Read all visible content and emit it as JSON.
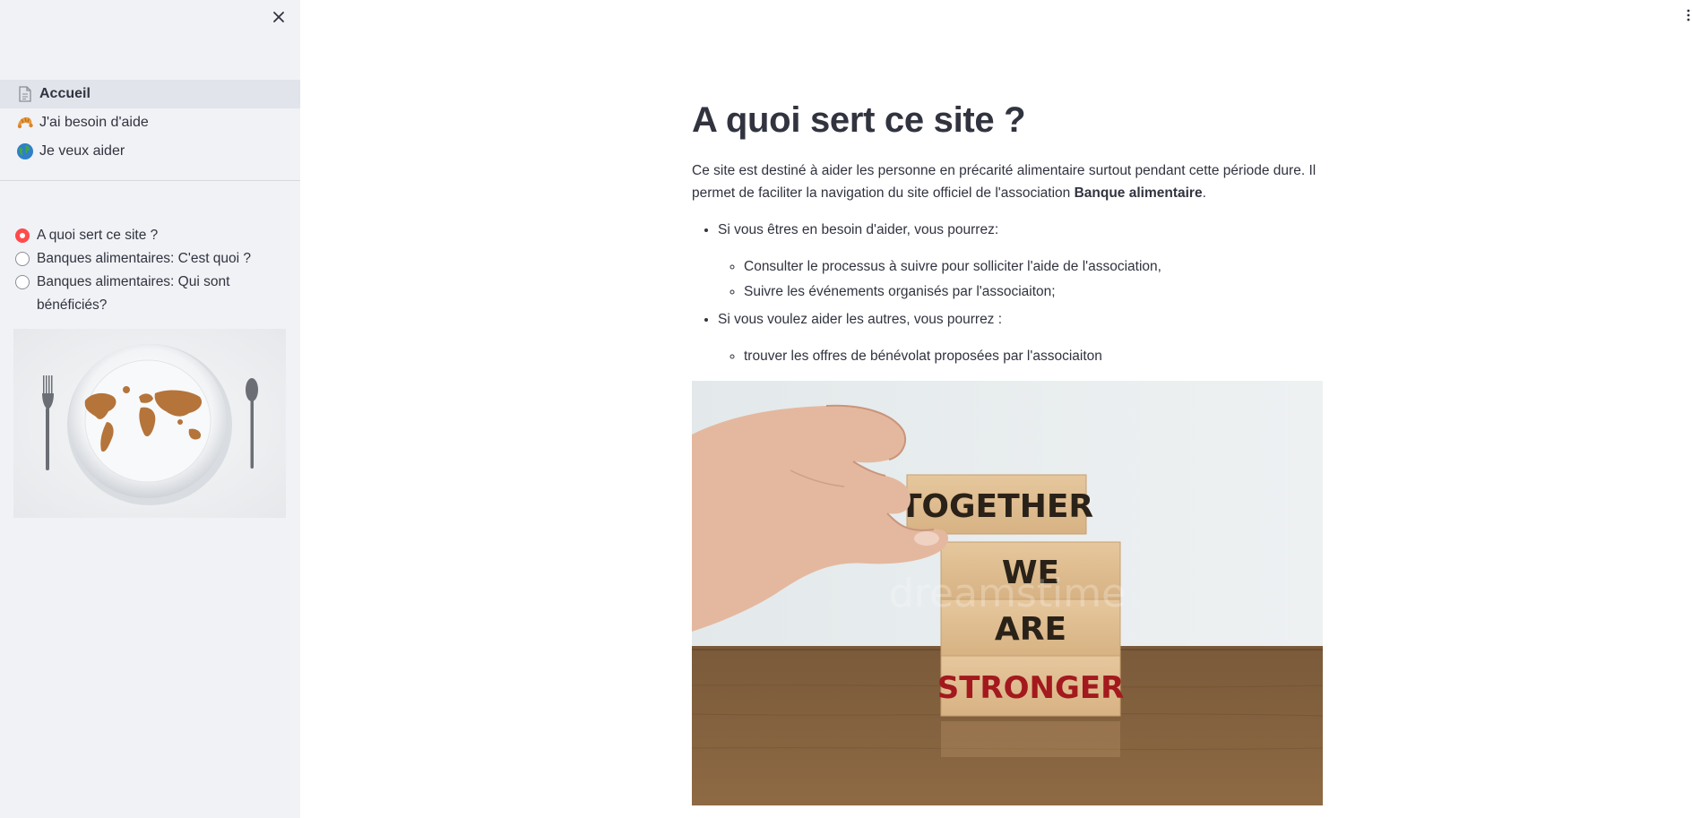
{
  "sidebar": {
    "nav": [
      {
        "label": "Accueil",
        "icon": "document-icon",
        "active": true
      },
      {
        "label": "J'ai besoin d'aide",
        "icon": "croissant-icon",
        "active": false
      },
      {
        "label": "Je veux aider",
        "icon": "globe-icon",
        "active": false
      }
    ],
    "radios": [
      {
        "label": "A quoi sert ce site ?",
        "checked": true
      },
      {
        "label": "Banques alimentaires: C'est quoi ?",
        "checked": false
      },
      {
        "label": "Banques alimentaires: Qui sont bénéficiés?",
        "checked": false
      }
    ],
    "image_alt": "plate-world-map-icon"
  },
  "main": {
    "title": "A quoi sert ce site ?",
    "intro_text": "Ce site est destiné à aider les personne en précarité alimentaire surtout pendant cette période dure. Il permet de faciliter la navigation du site officiel de l'association ",
    "intro_bold": "Banque alimentaire",
    "intro_end": ".",
    "bullets": [
      {
        "text": "Si vous êtres en besoin d'aider, vous pourrez:",
        "sub": [
          "Consulter le processus à suivre pour solliciter l'aide de l'association,",
          "Suivre les événements organisés par l'associaiton;"
        ]
      },
      {
        "text": "Si vous voulez aider les autres, vous pourrez :",
        "sub": [
          "trouver les offres de bénévolat proposées par l'associaiton"
        ]
      }
    ],
    "hero_blocks": [
      "TOGETHER",
      "WE",
      "ARE",
      "STRONGER"
    ],
    "watermark": "dreamstime"
  },
  "colors": {
    "accent": "#ff4b4b",
    "sidebar_bg": "#f0f2f6",
    "text": "#31333f",
    "stronger_red": "#a3191d"
  }
}
